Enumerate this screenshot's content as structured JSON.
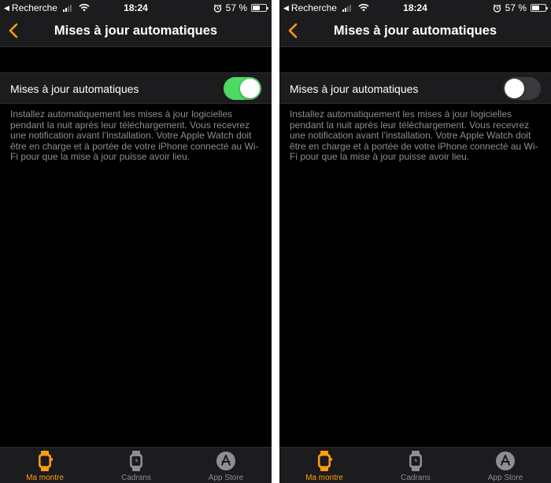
{
  "colors": {
    "accent": "#ff9f0a",
    "toggle_on": "#4cd964",
    "toggle_off": "#3a3a3c",
    "background": "#000000",
    "secondary_text": "#8e8e93"
  },
  "screens": [
    {
      "status_bar": {
        "back_app": "Recherche",
        "time": "18:24",
        "battery": "57 %",
        "battery_level": 0.57
      },
      "nav": {
        "title": "Mises à jour automatiques",
        "back_icon": "chevron-left-icon"
      },
      "setting": {
        "label": "Mises à jour automatiques",
        "toggle_state": "on"
      },
      "footer": "Installez automatiquement les mises à jour logicielles pendant la nuit après leur téléchargement. Vous recevrez une notification avant l’installation. Votre Apple Watch doit être en charge et à portée de votre iPhone connecté au Wi-Fi pour que la mise à jour puisse avoir lieu.",
      "tabs": [
        {
          "label": "Ma montre",
          "icon": "watch-icon",
          "active": true
        },
        {
          "label": "Cadrans",
          "icon": "watch-face-icon",
          "active": false
        },
        {
          "label": "App Store",
          "icon": "app-store-icon",
          "active": false
        }
      ]
    },
    {
      "status_bar": {
        "back_app": "Recherche",
        "time": "18:24",
        "battery": "57 %",
        "battery_level": 0.57
      },
      "nav": {
        "title": "Mises à jour automatiques",
        "back_icon": "chevron-left-icon"
      },
      "setting": {
        "label": "Mises à jour automatiques",
        "toggle_state": "off"
      },
      "footer": "Installez automatiquement les mises à jour logicielles pendant la nuit après leur téléchargement. Vous recevrez une notification avant l’installation. Votre Apple Watch doit être en charge et à portée de votre iPhone connecté au Wi-Fi pour que la mise à jour puisse avoir lieu.",
      "tabs": [
        {
          "label": "Ma montre",
          "icon": "watch-icon",
          "active": true
        },
        {
          "label": "Cadrans",
          "icon": "watch-face-icon",
          "active": false
        },
        {
          "label": "App Store",
          "icon": "app-store-icon",
          "active": false
        }
      ]
    }
  ]
}
